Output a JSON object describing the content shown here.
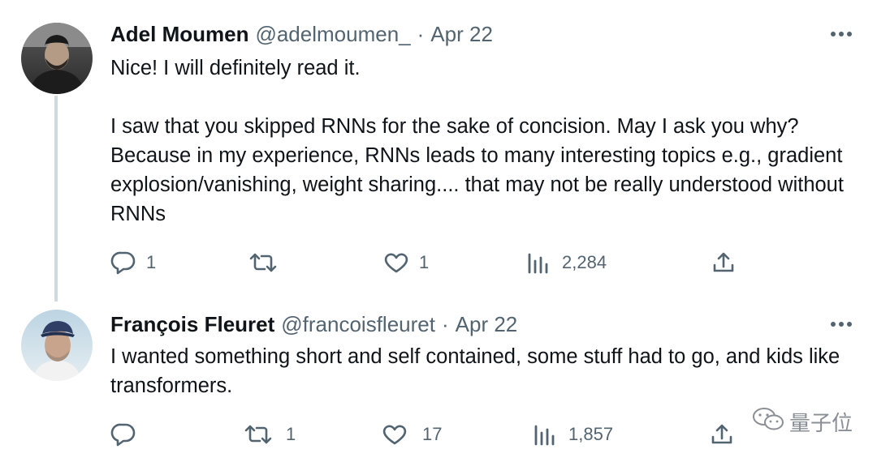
{
  "tweets": [
    {
      "author_name": "Adel Moumen",
      "handle": "@adelmoumen_",
      "separator": "·",
      "date": "Apr 22",
      "body": "Nice! I will definitely read it.\n\nI saw that you skipped RNNs for the sake of concision. May I ask you why? Because in my experience, RNNs leads to many interesting topics e.g., gradient explosion/vanishing, weight sharing.... that may not be really understood without RNNs",
      "replies": "1",
      "retweets": "",
      "likes": "1",
      "views": "2,284",
      "icons": [
        "reply-icon",
        "retweet-icon",
        "like-icon",
        "views-icon",
        "share-icon",
        "more-icon"
      ]
    },
    {
      "author_name": "François Fleuret",
      "handle": "@francoisfleuret",
      "separator": "·",
      "date": "Apr 22",
      "body": "I wanted something short and self contained, some stuff had to go, and kids like transformers.",
      "replies": "",
      "retweets": "1",
      "likes": "17",
      "views": "1,857",
      "icons": [
        "reply-icon",
        "retweet-icon",
        "like-icon",
        "views-icon",
        "share-icon",
        "more-icon"
      ]
    }
  ],
  "watermark": {
    "text": "量子位",
    "icon": "wechat-icon"
  },
  "colors": {
    "text": "#0f1419",
    "secondary": "#536471",
    "thread_line": "#cfd9de",
    "background": "#ffffff"
  }
}
